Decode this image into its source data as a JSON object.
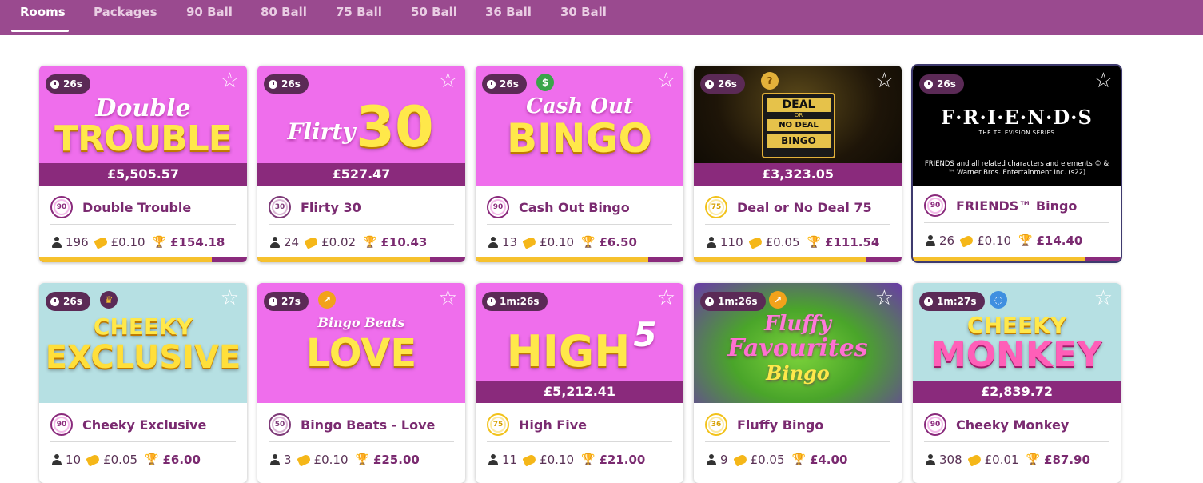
{
  "nav": {
    "tabs": [
      "Rooms",
      "Packages",
      "90 Ball",
      "80 Ball",
      "75 Ball",
      "50 Ball",
      "36 Ball",
      "30 Ball"
    ],
    "active": "Rooms"
  },
  "colors": {
    "nav_bg": "#9a4a8f",
    "brand_purple": "#8a2a7c",
    "accent_yellow": "#f6c12d",
    "pink_banner": "#ef6eec",
    "mint_banner": "#b6e0e3"
  },
  "rooms": [
    {
      "timer": "26s",
      "logo_top": "Double",
      "logo_main": "TROUBLE",
      "jackpot": "£5,505.57",
      "ball": "90",
      "name": "Double Trouble",
      "players": "196",
      "price": "£0.10",
      "prize": "£154.18",
      "progress": 0.83
    },
    {
      "timer": "26s",
      "logo_top": "Flirty",
      "logo_main": "30",
      "jackpot": "£527.47",
      "ball": "30",
      "name": "Flirty 30",
      "players": "24",
      "price": "£0.02",
      "prize": "£10.43",
      "progress": 0.83
    },
    {
      "timer": "26s",
      "badge_icon": "money-bag-icon",
      "logo_top": "Cash Out",
      "logo_main": "BINGO",
      "ball": "90",
      "name": "Cash Out Bingo",
      "players": "13",
      "price": "£0.10",
      "prize": "£6.50",
      "progress": 0.83
    },
    {
      "timer": "26s",
      "badge_icon": "question-icon",
      "logo_top": "DEAL",
      "logo_mid": "OR",
      "logo_mid2": "NO DEAL",
      "logo_main": "BINGO",
      "jackpot": "£3,323.05",
      "ball": "75",
      "name": "Deal or No Deal 75",
      "players": "110",
      "price": "£0.05",
      "prize": "£111.54",
      "progress": 0.83
    },
    {
      "timer": "26s",
      "logo_main": "F·R·I·E·N·D·S",
      "logo_sub": "THE TELEVISION SERIES",
      "copyright": "FRIENDS and all related characters and elements © & ™ Warner Bros. Entertainment Inc. (s22)",
      "ball": "90",
      "name": "FRIENDS™ Bingo",
      "players": "26",
      "price": "£0.10",
      "prize": "£14.40",
      "progress": 0.83
    },
    {
      "timer": "26s",
      "badge_icon": "trophy-icon",
      "logo_top": "CHEEKY",
      "logo_main": "EXCLUSIVE",
      "ball": "90",
      "name": "Cheeky Exclusive",
      "players": "10",
      "price": "£0.05",
      "prize": "£6.00"
    },
    {
      "timer": "27s",
      "badge_icon": "trending-icon",
      "logo_top": "Bingo Beats",
      "logo_main": "LOVE",
      "ball": "50",
      "name": "Bingo Beats - Love",
      "players": "3",
      "price": "£0.10",
      "prize": "£25.00"
    },
    {
      "timer": "1m:26s",
      "logo_main": "HIGH",
      "logo_sup": "5",
      "jackpot": "£5,212.41",
      "ball": "75",
      "name": "High Five",
      "players": "11",
      "price": "£0.10",
      "prize": "£21.00"
    },
    {
      "timer": "1m:26s",
      "badge_icon": "trending-icon",
      "logo_top": "Fluffy",
      "logo_main": "Favourites",
      "logo_sub": "Bingo",
      "ball": "36",
      "name": "Fluffy Bingo",
      "players": "9",
      "price": "£0.05",
      "prize": "£4.00"
    },
    {
      "timer": "1m:27s",
      "badge_icon": "spinner-icon",
      "logo_top": "CHEEKY",
      "logo_main": "MONKEY",
      "jackpot": "£2,839.72",
      "ball": "90",
      "name": "Cheeky Monkey",
      "players": "308",
      "price": "£0.01",
      "prize": "£87.90"
    }
  ]
}
